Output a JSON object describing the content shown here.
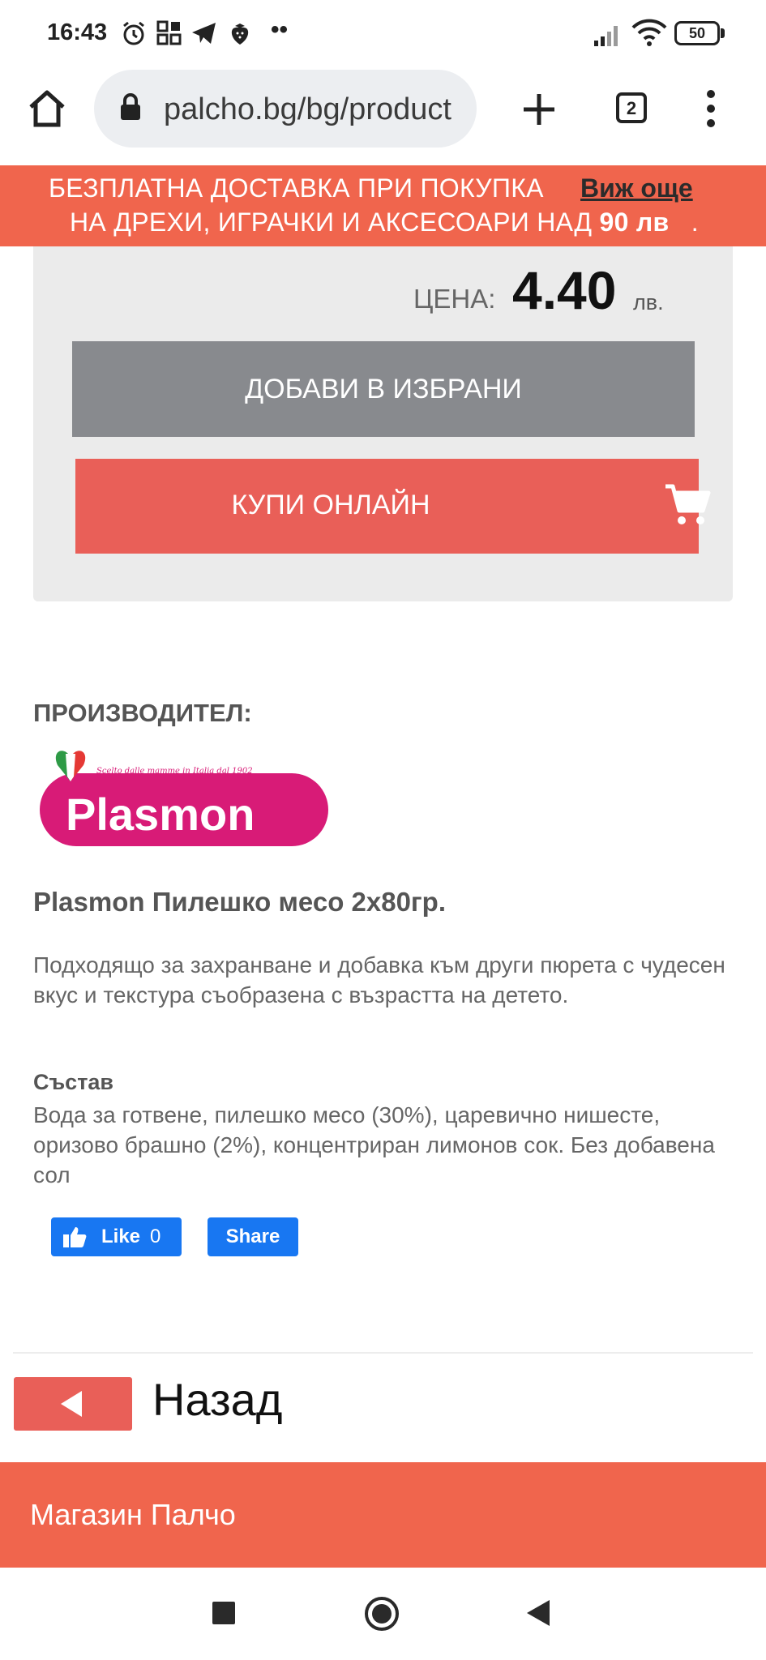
{
  "status_bar": {
    "time": "16:43",
    "battery": "50",
    "dots": "••",
    "left_icons": [
      "alarm-icon",
      "grid-icon",
      "telegram-icon",
      "strawberry-icon"
    ],
    "right_icons": [
      "signal-icon",
      "wifi-icon",
      "battery-icon"
    ]
  },
  "browser": {
    "url": "palcho.bg/bg/product",
    "tab_count": "2",
    "icons": [
      "home-icon",
      "lock-icon",
      "new-tab-icon",
      "tabs-icon",
      "menu-icon"
    ]
  },
  "promo": {
    "line1": "БЕЗПЛАТНА ДОСТАВКА ПРИ ПОКУПКА",
    "line2": "НА ДРЕХИ, ИГРАЧКИ И АКСЕСОАРИ НАД",
    "amount": "90 лв",
    "trailing": ".",
    "more_link": "Виж още"
  },
  "price": {
    "label": "ЦЕНА:",
    "value": "4.40",
    "currency": "лв."
  },
  "actions": {
    "favorites": "ДОБАВИ В ИЗБРАНИ",
    "buy": "КУПИ ОНЛАЙН"
  },
  "product": {
    "manufacturer_label": "ПРОИЗВОДИТЕЛ:",
    "brand_name": "Plasmon",
    "brand_tagline": "Scelto dalle mamme in Italia dal 1902",
    "title": "Plasmon Пилешко месо 2х80гр.",
    "description": "Подходящо за захранване и добавка към други пюрета с чудесен вкус и текстура съобразена с възрастта на детето.",
    "composition_label": "Състав",
    "composition": "Вода за готвене, пилешко месо (30%), царевично нишесте, оризово брашно (2%), концентриран лимонов сок. Без добавена сол"
  },
  "social": {
    "like_label": "Like",
    "like_count": "0",
    "share_label": "Share"
  },
  "navigation": {
    "back_label": "Назад",
    "footer_title": "Магазин Палчо"
  },
  "colors": {
    "accent": "#f0654d",
    "button_red": "#e95f58",
    "button_gray": "#888a8e",
    "facebook_blue": "#1877f2",
    "brand_pink": "#d81b77"
  }
}
